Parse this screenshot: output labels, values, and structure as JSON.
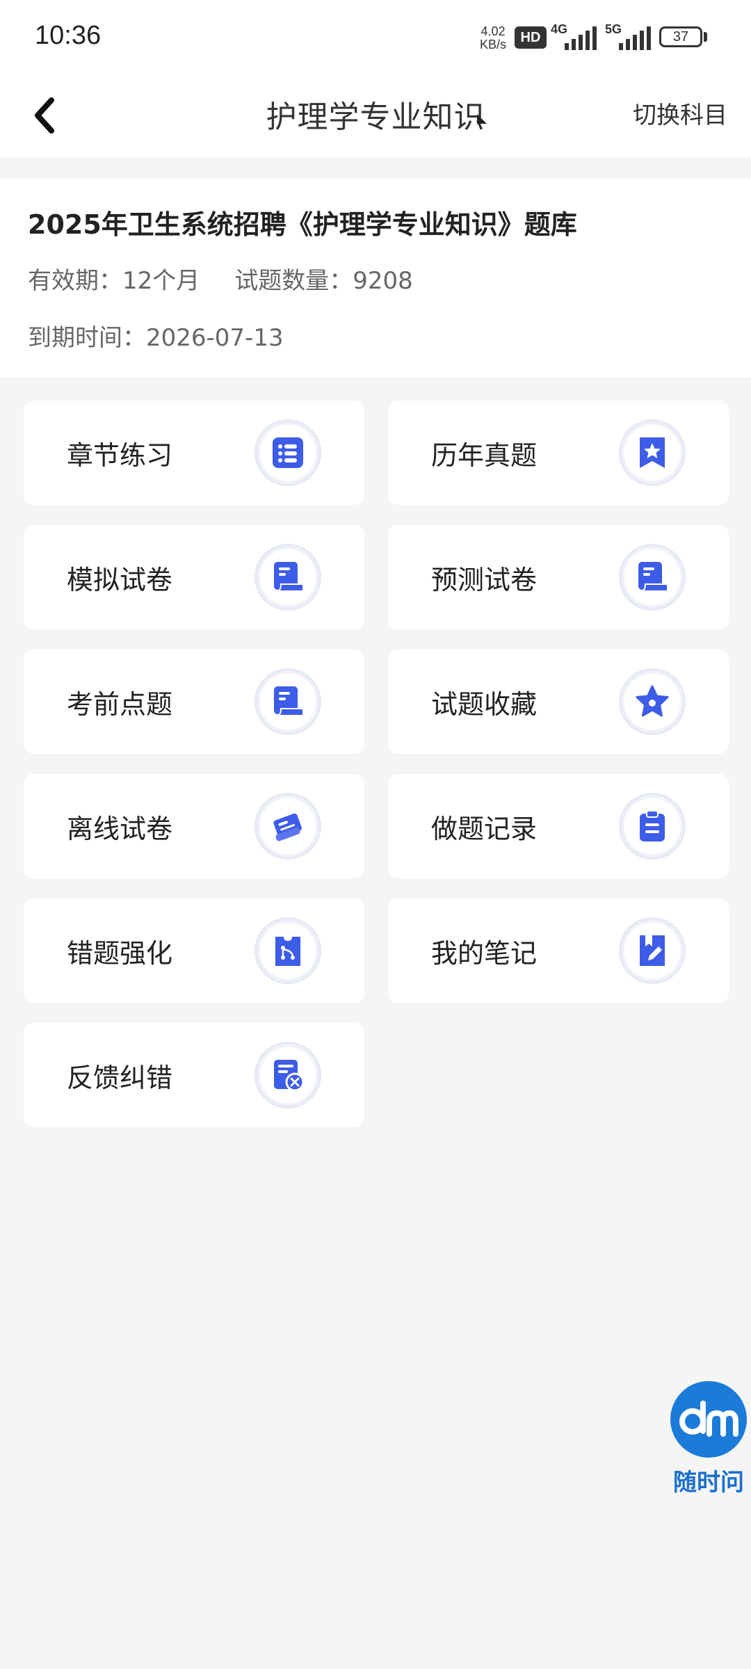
{
  "status_bar": {
    "time": "10:36",
    "net_speed": "4.02\nKB/s",
    "hd_label": "HD",
    "net1": "4G",
    "net2": "5G",
    "battery": "37"
  },
  "nav": {
    "title": "护理学专业知识",
    "switch_label": "切换科目"
  },
  "bank": {
    "title": "2025年卫生系统招聘《护理学专业知识》题库",
    "validity": "有效期：12个月",
    "question_count": "试题数量：9208",
    "expiry": "到期时间：2026-07-13"
  },
  "menu": [
    {
      "label": "章节练习",
      "icon": "list-icon"
    },
    {
      "label": "历年真题",
      "icon": "bookmark-star-icon"
    },
    {
      "label": "模拟试卷",
      "icon": "scroll-paper-icon"
    },
    {
      "label": "预测试卷",
      "icon": "scroll-paper-icon"
    },
    {
      "label": "考前点题",
      "icon": "scroll-paper-icon"
    },
    {
      "label": "试题收藏",
      "icon": "star-icon"
    },
    {
      "label": "离线试卷",
      "icon": "offline-paper-icon"
    },
    {
      "label": "做题记录",
      "icon": "clipboard-icon"
    },
    {
      "label": "错题强化",
      "icon": "wrong-question-icon"
    },
    {
      "label": "我的笔记",
      "icon": "note-pencil-icon"
    },
    {
      "label": "反馈纠错",
      "icon": "feedback-error-icon"
    }
  ],
  "fab": {
    "label": "随时问",
    "icon": "dm-logo-icon"
  },
  "colors": {
    "accent": "#3d5ce8",
    "fab": "#1a7bd9",
    "background": "#f5f5f4"
  }
}
